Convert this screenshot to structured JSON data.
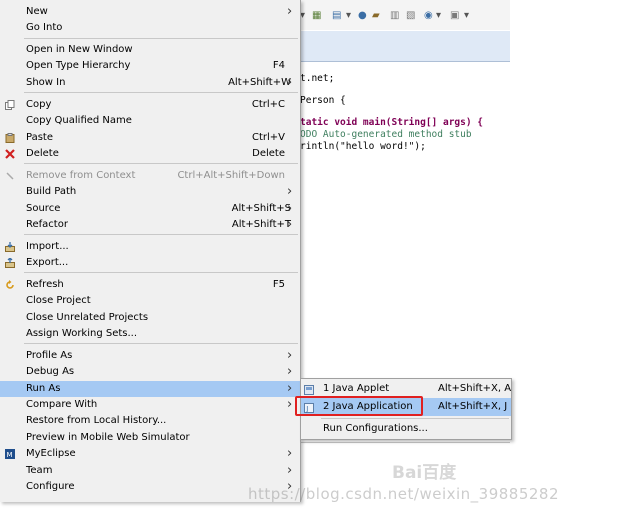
{
  "menu": {
    "items": [
      {
        "label": "New",
        "shortcut": "",
        "submenu": true,
        "icon": "",
        "disabled": false
      },
      {
        "label": "Go Into",
        "shortcut": "",
        "submenu": false,
        "icon": "",
        "disabled": false
      },
      {
        "label": "Open in New Window",
        "shortcut": "",
        "submenu": false,
        "icon": "",
        "disabled": false
      },
      {
        "label": "Open Type Hierarchy",
        "shortcut": "F4",
        "submenu": false,
        "icon": "",
        "disabled": false
      },
      {
        "label": "Show In",
        "shortcut": "Alt+Shift+W",
        "submenu": true,
        "icon": "",
        "disabled": false
      },
      {
        "label": "Copy",
        "shortcut": "Ctrl+C",
        "submenu": false,
        "icon": "copy-icon",
        "disabled": false
      },
      {
        "label": "Copy Qualified Name",
        "shortcut": "",
        "submenu": false,
        "icon": "",
        "disabled": false
      },
      {
        "label": "Paste",
        "shortcut": "Ctrl+V",
        "submenu": false,
        "icon": "paste-icon",
        "disabled": false
      },
      {
        "label": "Delete",
        "shortcut": "Delete",
        "submenu": false,
        "icon": "delete-icon",
        "disabled": false
      },
      {
        "label": "Remove from Context",
        "shortcut": "Ctrl+Alt+Shift+Down",
        "submenu": false,
        "icon": "remove-context-icon",
        "disabled": true
      },
      {
        "label": "Build Path",
        "shortcut": "",
        "submenu": true,
        "icon": "",
        "disabled": false
      },
      {
        "label": "Source",
        "shortcut": "Alt+Shift+S",
        "submenu": true,
        "icon": "",
        "disabled": false
      },
      {
        "label": "Refactor",
        "shortcut": "Alt+Shift+T",
        "submenu": true,
        "icon": "",
        "disabled": false
      },
      {
        "label": "Import...",
        "shortcut": "",
        "submenu": false,
        "icon": "import-icon",
        "disabled": false
      },
      {
        "label": "Export...",
        "shortcut": "",
        "submenu": false,
        "icon": "export-icon",
        "disabled": false
      },
      {
        "label": "Refresh",
        "shortcut": "F5",
        "submenu": false,
        "icon": "refresh-icon",
        "disabled": false
      },
      {
        "label": "Close Project",
        "shortcut": "",
        "submenu": false,
        "icon": "",
        "disabled": false
      },
      {
        "label": "Close Unrelated Projects",
        "shortcut": "",
        "submenu": false,
        "icon": "",
        "disabled": false
      },
      {
        "label": "Assign Working Sets...",
        "shortcut": "",
        "submenu": false,
        "icon": "",
        "disabled": false
      },
      {
        "label": "Profile As",
        "shortcut": "",
        "submenu": true,
        "icon": "",
        "disabled": false
      },
      {
        "label": "Debug As",
        "shortcut": "",
        "submenu": true,
        "icon": "",
        "disabled": false
      },
      {
        "label": "Run As",
        "shortcut": "",
        "submenu": true,
        "icon": "",
        "disabled": false,
        "highlighted": true
      },
      {
        "label": "Compare With",
        "shortcut": "",
        "submenu": true,
        "icon": "",
        "disabled": false
      },
      {
        "label": "Restore from Local History...",
        "shortcut": "",
        "submenu": false,
        "icon": "",
        "disabled": false
      },
      {
        "label": "Preview in Mobile Web Simulator",
        "shortcut": "",
        "submenu": false,
        "icon": "",
        "disabled": false
      },
      {
        "label": "MyEclipse",
        "shortcut": "",
        "submenu": true,
        "icon": "myeclipse-icon",
        "disabled": false
      },
      {
        "label": "Team",
        "shortcut": "",
        "submenu": true,
        "icon": "",
        "disabled": false
      },
      {
        "label": "Configure",
        "shortcut": "",
        "submenu": true,
        "icon": "",
        "disabled": false
      }
    ]
  },
  "submenu": {
    "items": [
      {
        "label": "1 Java Applet",
        "shortcut": "Alt+Shift+X, A",
        "icon": "java-applet-icon",
        "highlighted": false
      },
      {
        "label": "2 Java Application",
        "shortcut": "Alt+Shift+X, J",
        "icon": "java-application-icon",
        "highlighted": true
      },
      {
        "label": "Run Configurations...",
        "shortcut": "",
        "icon": "",
        "highlighted": false
      }
    ]
  },
  "editor": {
    "lines": [
      "t.net;",
      "Person {",
      "tatic void main(String[] args) {",
      "ODO Auto-generated method stub",
      "rintln(\"hello word!\");"
    ]
  },
  "watermark": {
    "url": "https://blog.csdn.net/weixin_39885282",
    "brand": "Bai百度"
  },
  "colors": {
    "highlight": "#a5c9f3",
    "callout": "#e02020",
    "menu_bg": "#f0f0f0"
  }
}
